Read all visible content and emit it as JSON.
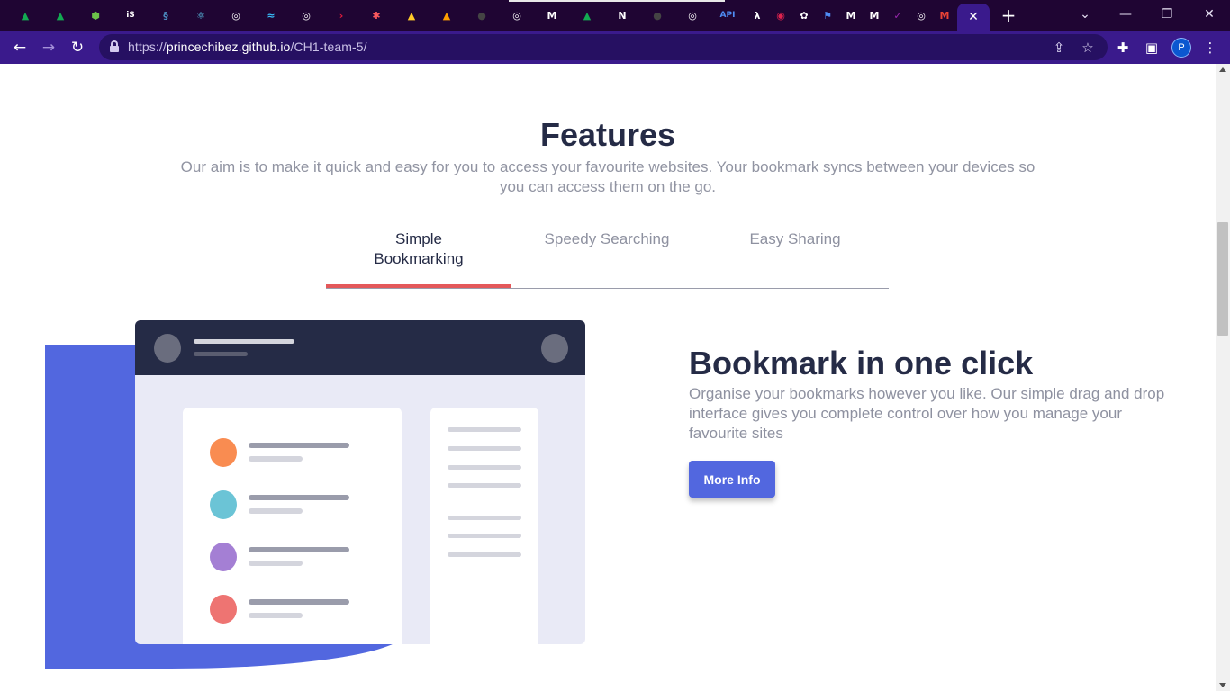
{
  "browser": {
    "tabs": [
      {
        "icon": "mongodb-leaf-icon",
        "color": "#13aa52",
        "glyph": "▲"
      },
      {
        "icon": "mongodb-leaf-icon",
        "color": "#13aa52",
        "glyph": "▲"
      },
      {
        "icon": "nodejs-hexagon-icon",
        "color": "#6cc24a",
        "glyph": "⬢"
      },
      {
        "icon": "is-text-icon",
        "color": "#ffffff",
        "glyph": "iS"
      },
      {
        "icon": "python-snake-icon",
        "color": "#4b8bbe",
        "glyph": "§"
      },
      {
        "icon": "react-atom-icon",
        "color": "#61dafb",
        "glyph": "⚛"
      },
      {
        "icon": "globe-icon",
        "color": "#ffffff",
        "glyph": "◎"
      },
      {
        "icon": "tailwind-wave-icon",
        "color": "#38bdf8",
        "glyph": "≈"
      },
      {
        "icon": "globe-icon",
        "color": "#ffffff",
        "glyph": "◎"
      },
      {
        "icon": "chevron-right-red-icon",
        "color": "#e21b3c",
        "glyph": "›"
      },
      {
        "icon": "asterisk-icon",
        "color": "#ff5a5f",
        "glyph": "✱"
      },
      {
        "icon": "firebase-flame-icon",
        "color": "#ffca28",
        "glyph": "▲"
      },
      {
        "icon": "firebase-flame-icon",
        "color": "#ffa000",
        "glyph": "▲"
      },
      {
        "icon": "github-icon",
        "color": "#444444",
        "glyph": "●"
      },
      {
        "icon": "globe-icon",
        "color": "#ffffff",
        "glyph": "◎"
      },
      {
        "icon": "m-red-square-icon",
        "color": "#ffffff",
        "glyph": "M"
      },
      {
        "icon": "mongodb-leaf-icon",
        "color": "#13aa52",
        "glyph": "▲"
      },
      {
        "icon": "nextjs-n-icon",
        "color": "#ffffff",
        "glyph": "N"
      },
      {
        "icon": "github-icon",
        "color": "#444444",
        "glyph": "●"
      },
      {
        "icon": "globe-icon",
        "color": "#ffffff",
        "glyph": "◎"
      },
      {
        "icon": "api-text-icon",
        "color": "#4f8df5",
        "glyph": "API"
      },
      {
        "icon": "lambda-icon",
        "color": "#ffffff",
        "glyph": "λ"
      },
      {
        "icon": "nestjs-red-icon",
        "color": "#e0234e",
        "glyph": "◉"
      },
      {
        "icon": "openai-icon",
        "color": "#ffffff",
        "glyph": "✿"
      },
      {
        "icon": "flag-icon",
        "color": "#4f8df5",
        "glyph": "⚑"
      },
      {
        "icon": "medium-m-icon",
        "color": "#ffffff",
        "glyph": "M"
      },
      {
        "icon": "medium-m-icon",
        "color": "#ffffff",
        "glyph": "M"
      },
      {
        "icon": "purple-check-icon",
        "color": "#9c27b0",
        "glyph": "✓"
      },
      {
        "icon": "globe-icon",
        "color": "#ffffff",
        "glyph": "◎"
      },
      {
        "icon": "gmail-icon",
        "color": "#ea4335",
        "glyph": "M"
      }
    ],
    "active_tab_close": "✕",
    "new_tab": "+",
    "url_scheme": "https://",
    "url_host": "princechibez.github.io",
    "url_path": "/CH1-team-5/",
    "avatar_letter": "P"
  },
  "page": {
    "features_title": "Features",
    "features_subtitle": "Our aim is to make it quick and easy for you to access your favourite websites. Your bookmark syncs between your devices so you can access them on the go.",
    "tabs": [
      {
        "label": "Simple Bookmarking",
        "active": true
      },
      {
        "label": "Speedy Searching",
        "active": false
      },
      {
        "label": "Easy Sharing",
        "active": false
      }
    ],
    "panel": {
      "title": "Bookmark in one click",
      "text": "Organise your bookmarks however you like. Our simple drag and drop interface gives you complete control over how you manage your favourite sites",
      "button": "More Info"
    },
    "colors": {
      "accent_blue": "#5267df",
      "accent_red": "#e4585a",
      "dark": "#252b46",
      "grey_text": "#8e91a0",
      "bookmark_orange": "#f98c51",
      "bookmark_teal": "#6bc4d6",
      "bookmark_purple": "#a47fd4",
      "bookmark_red": "#ee7472"
    }
  }
}
